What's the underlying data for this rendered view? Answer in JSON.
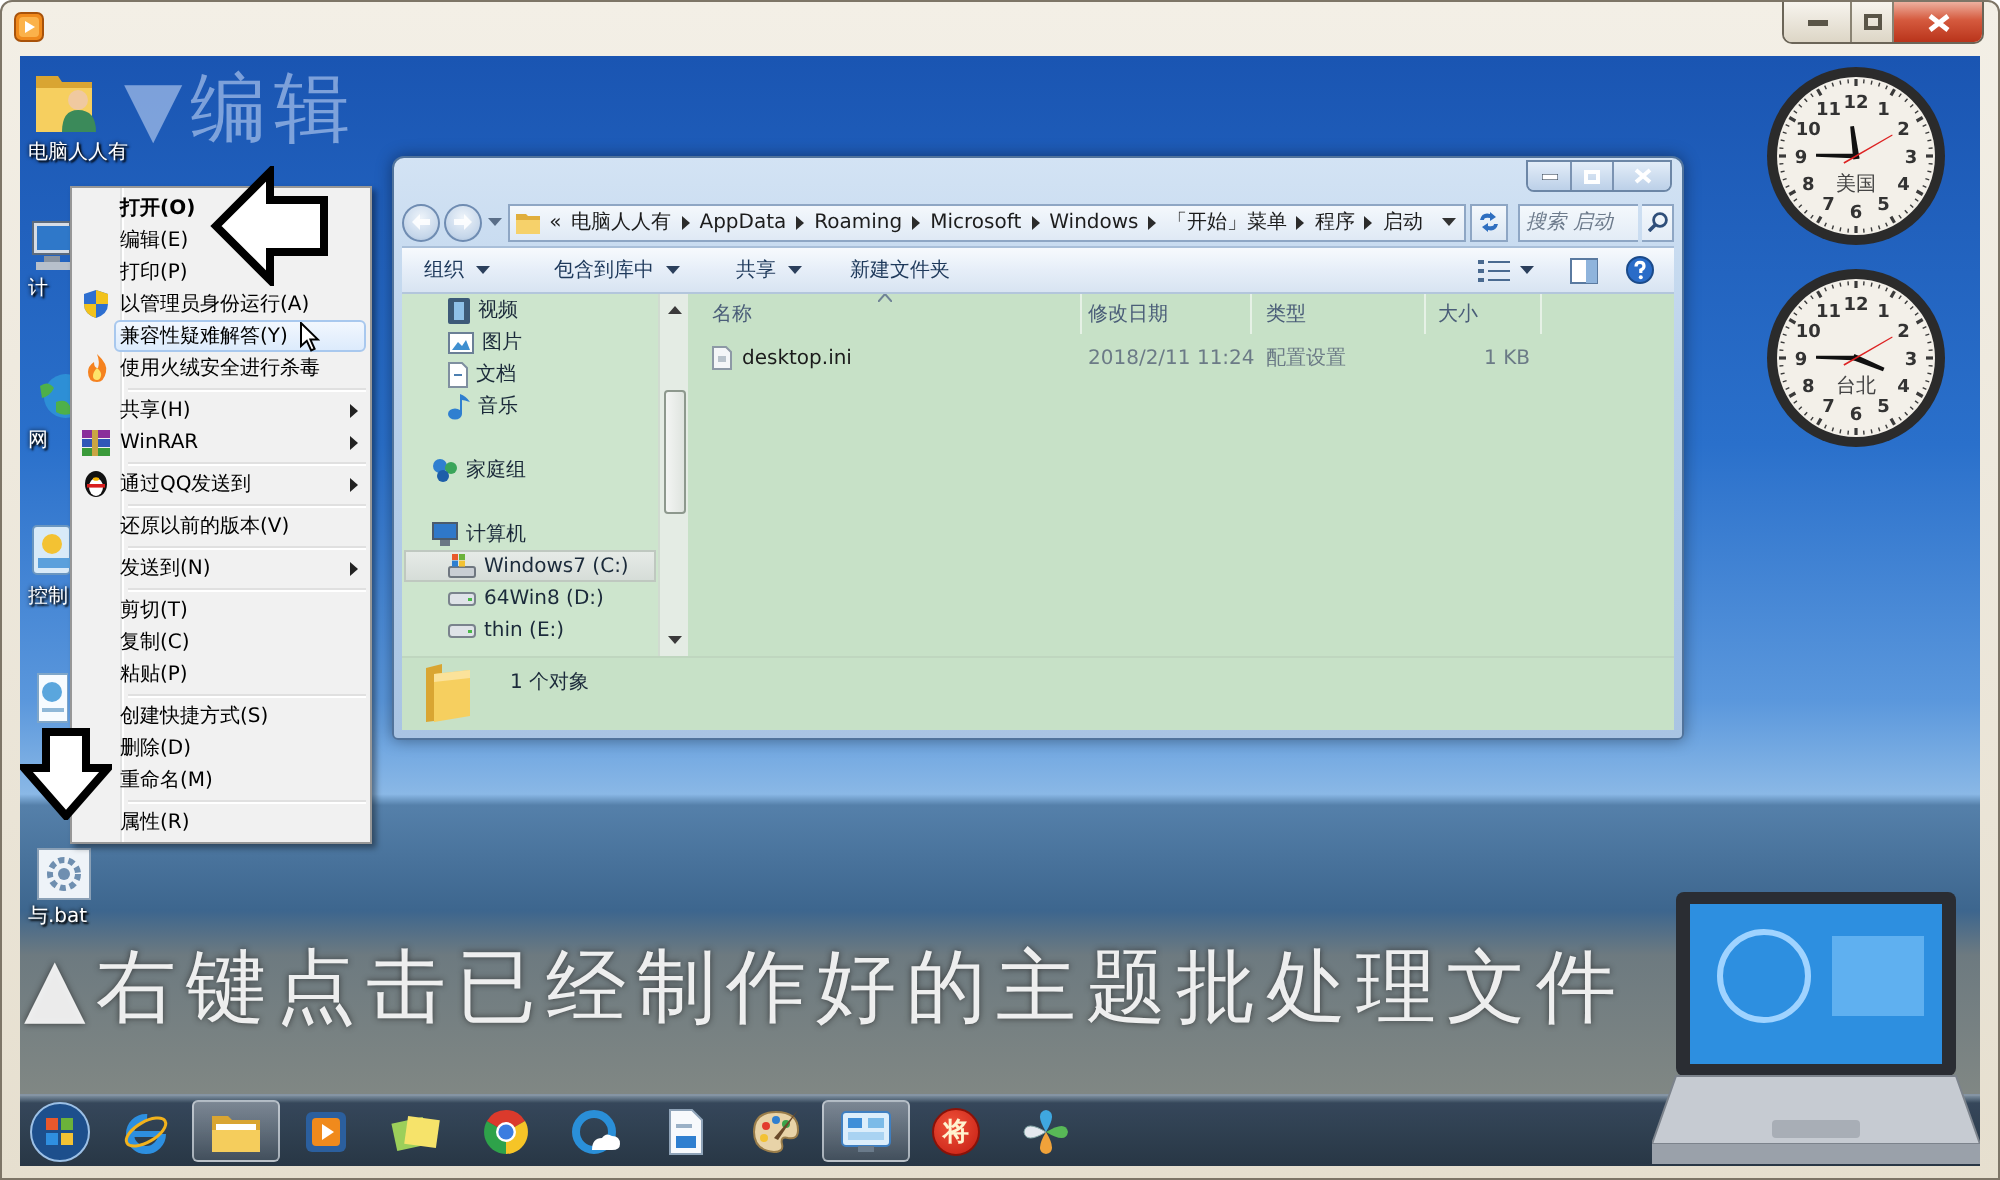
{
  "desktop": {
    "icons": [
      {
        "kind": "user-folder",
        "label": "电脑人人有"
      },
      {
        "kind": "computer",
        "label": "计"
      },
      {
        "kind": "network",
        "label": "网"
      },
      {
        "kind": "control-panel",
        "label": "控制"
      },
      {
        "kind": "document"
      },
      {
        "kind": "batch-file",
        "label": "与.bat"
      }
    ],
    "captions": [
      {
        "kind": "top",
        "text": "▼编辑"
      },
      {
        "kind": "bottom",
        "text": "▲右键点击已经制作好的主题批处理文件"
      }
    ],
    "clocks": [
      {
        "label": "美国",
        "numerals": [
          "12",
          "11",
          "1",
          "10",
          "2",
          "9",
          "3",
          "8",
          "4",
          "7",
          "5",
          "6"
        ]
      },
      {
        "label": "台北",
        "numerals": [
          "12",
          "11",
          "1",
          "10",
          "2",
          "9",
          "3",
          "8",
          "4",
          "7",
          "5",
          "6"
        ]
      }
    ]
  },
  "context_menu": {
    "items": [
      {
        "kind": "item",
        "label": "打开(O)",
        "default": true,
        "selected": false,
        "submenu": false
      },
      {
        "kind": "item",
        "label": "编辑(E)",
        "default": false,
        "selected": false,
        "submenu": false
      },
      {
        "kind": "item",
        "label": "打印(P)",
        "default": false,
        "selected": false,
        "submenu": false
      },
      {
        "kind": "item",
        "label": "以管理员身份运行(A)",
        "default": false,
        "selected": false,
        "submenu": false
      },
      {
        "kind": "item",
        "label": "兼容性疑难解答(Y)",
        "default": false,
        "selected": true,
        "submenu": false
      },
      {
        "kind": "item",
        "label": "使用火绒安全进行杀毒",
        "default": false,
        "selected": false,
        "submenu": false
      },
      {
        "kind": "separator"
      },
      {
        "kind": "item",
        "label": "共享(H)",
        "default": false,
        "selected": false,
        "submenu": true
      },
      {
        "kind": "item",
        "label": "WinRAR",
        "default": false,
        "selected": false,
        "submenu": true
      },
      {
        "kind": "separator"
      },
      {
        "kind": "item",
        "label": "通过QQ发送到",
        "default": false,
        "selected": false,
        "submenu": true
      },
      {
        "kind": "separator"
      },
      {
        "kind": "item",
        "label": "还原以前的版本(V)",
        "default": false,
        "selected": false,
        "submenu": false
      },
      {
        "kind": "separator"
      },
      {
        "kind": "item",
        "label": "发送到(N)",
        "default": false,
        "selected": false,
        "submenu": true
      },
      {
        "kind": "separator"
      },
      {
        "kind": "item",
        "label": "剪切(T)",
        "default": false,
        "selected": false,
        "submenu": false
      },
      {
        "kind": "item",
        "label": "复制(C)",
        "default": false,
        "selected": false,
        "submenu": false
      },
      {
        "kind": "item",
        "label": "粘贴(P)",
        "default": false,
        "selected": false,
        "submenu": false
      },
      {
        "kind": "separator"
      },
      {
        "kind": "item",
        "label": "创建快捷方式(S)",
        "default": false,
        "selected": false,
        "submenu": false
      },
      {
        "kind": "item",
        "label": "删除(D)",
        "default": false,
        "selected": false,
        "submenu": false
      },
      {
        "kind": "item",
        "label": "重命名(M)",
        "default": false,
        "selected": false,
        "submenu": false
      },
      {
        "kind": "separator"
      },
      {
        "kind": "item",
        "label": "属性(R)",
        "default": false,
        "selected": false,
        "submenu": false
      }
    ]
  },
  "explorer": {
    "breadcrumb": {
      "overflow": "«",
      "parts": [
        "电脑人人有",
        "AppData",
        "Roaming",
        "Microsoft",
        "Windows",
        "「开始」菜单",
        "程序",
        "启动"
      ]
    },
    "search": {
      "placeholder": "搜索 启动"
    },
    "toolbar": [
      {
        "label": "组织",
        "dropdown": true
      },
      {
        "label": "包含到库中",
        "dropdown": true
      },
      {
        "label": "共享",
        "dropdown": true
      },
      {
        "label": "新建文件夹",
        "dropdown": false
      }
    ],
    "nav": [
      {
        "kind": "continued",
        "items": [
          {
            "kind": "video",
            "label": "视频",
            "selected": false
          },
          {
            "kind": "pictures",
            "label": "图片",
            "selected": false
          },
          {
            "kind": "documents",
            "label": "文档",
            "selected": false
          },
          {
            "kind": "music",
            "label": "音乐",
            "selected": false
          }
        ]
      },
      {
        "kind": "root",
        "items": [
          {
            "kind": "homegroup",
            "label": "家庭组",
            "selected": false
          }
        ]
      },
      {
        "kind": "root",
        "items": [
          {
            "kind": "computer",
            "label": "计算机",
            "selected": false,
            "children": [
              {
                "kind": "system-drive",
                "label": "Windows7 (C:)",
                "selected": true
              },
              {
                "kind": "drive",
                "label": "64Win8 (D:)",
                "selected": false
              },
              {
                "kind": "drive",
                "label": "thin (E:)",
                "selected": false
              }
            ]
          }
        ]
      }
    ],
    "columns": [
      {
        "label": "名称",
        "sorted": true
      },
      {
        "label": "修改日期",
        "sorted": false
      },
      {
        "label": "类型",
        "sorted": false
      },
      {
        "label": "大小",
        "sorted": false
      }
    ],
    "files": [
      {
        "name": "desktop.ini",
        "modified": "2018/2/11 11:24",
        "type": "配置设置",
        "size": "1 KB"
      }
    ],
    "status": "1 个对象"
  },
  "taskbar": {
    "items": [
      {
        "kind": "browser",
        "open": false
      },
      {
        "kind": "folder",
        "open": true
      },
      {
        "kind": "media",
        "open": false
      },
      {
        "kind": "notes",
        "open": false
      },
      {
        "kind": "chrome",
        "open": false
      },
      {
        "kind": "cloud",
        "open": false
      },
      {
        "kind": "document",
        "open": false
      },
      {
        "kind": "paint",
        "open": false
      },
      {
        "kind": "control-panel",
        "open": true
      },
      {
        "kind": "game",
        "open": false,
        "text": "将"
      },
      {
        "kind": "pinwheel",
        "open": false
      }
    ]
  }
}
